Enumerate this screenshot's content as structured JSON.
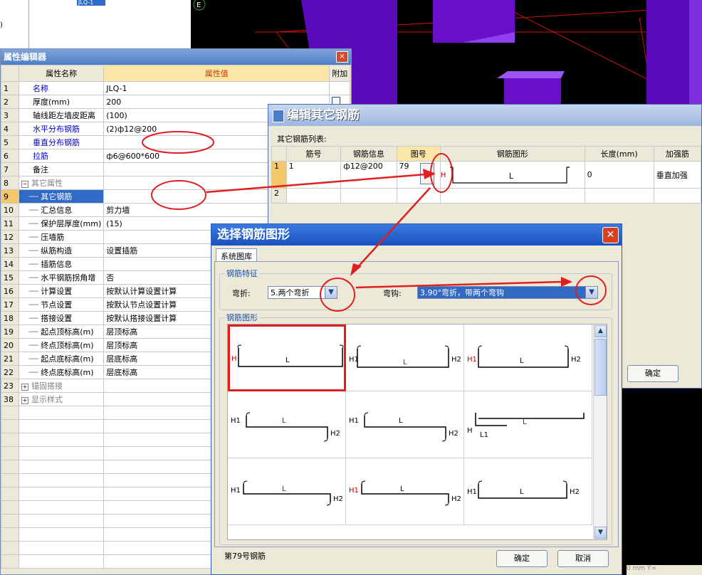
{
  "tree": {
    "selected_node": "JLQ-1",
    "left_fragment": ")"
  },
  "view3d": {
    "axis_label": "E"
  },
  "prop_editor": {
    "title": "属性编辑器",
    "close": "×",
    "headers": {
      "name": "属性名称",
      "value": "属性值",
      "add": "附加"
    },
    "rows": [
      {
        "n": "1",
        "name": "名称",
        "value": "JLQ-1",
        "style": "blue"
      },
      {
        "n": "2",
        "name": "厚度(mm)",
        "value": "200",
        "style": "normal",
        "check": true
      },
      {
        "n": "3",
        "name": "轴线距左墙皮距离",
        "value": "(100)",
        "style": "normal"
      },
      {
        "n": "4",
        "name": "水平分布钢筋",
        "value": "(2)ф12@200",
        "style": "blue"
      },
      {
        "n": "5",
        "name": "垂直分布钢筋",
        "value": "",
        "style": "blue"
      },
      {
        "n": "6",
        "name": "拉筋",
        "value": "ф6@600*600",
        "style": "blue"
      },
      {
        "n": "7",
        "name": "备注",
        "value": "",
        "style": "normal"
      },
      {
        "n": "8",
        "name": "其它属性",
        "value": "",
        "style": "group",
        "toggle": "−"
      },
      {
        "n": "9",
        "name": "其它钢筋",
        "value": "",
        "style": "child-selected"
      },
      {
        "n": "10",
        "name": "汇总信息",
        "value": "剪力墙",
        "style": "child"
      },
      {
        "n": "11",
        "name": "保护层厚度(mm)",
        "value": "(15)",
        "style": "child"
      },
      {
        "n": "12",
        "name": "压墙筋",
        "value": "",
        "style": "child"
      },
      {
        "n": "13",
        "name": "纵筋构造",
        "value": "设置插筋",
        "style": "child"
      },
      {
        "n": "14",
        "name": "插筋信息",
        "value": "",
        "style": "child"
      },
      {
        "n": "15",
        "name": "水平钢筋拐角增",
        "value": "否",
        "style": "child"
      },
      {
        "n": "16",
        "name": "计算设置",
        "value": "按默认计算设置计算",
        "style": "child"
      },
      {
        "n": "17",
        "name": "节点设置",
        "value": "按默认节点设置计算",
        "style": "child"
      },
      {
        "n": "18",
        "name": "搭接设置",
        "value": "按默认搭接设置计算",
        "style": "child"
      },
      {
        "n": "19",
        "name": "起点顶标高(m)",
        "value": "层顶标高",
        "style": "child"
      },
      {
        "n": "20",
        "name": "终点顶标高(m)",
        "value": "层顶标高",
        "style": "child"
      },
      {
        "n": "21",
        "name": "起点底标高(m)",
        "value": "层底标高",
        "style": "child"
      },
      {
        "n": "22",
        "name": "终点底标高(m)",
        "value": "层底标高",
        "style": "child"
      },
      {
        "n": "23",
        "name": "锚固搭接",
        "value": "",
        "style": "group",
        "toggle": "+"
      },
      {
        "n": "38",
        "name": "显示样式",
        "value": "",
        "style": "group",
        "toggle": "+"
      }
    ]
  },
  "edit_dialog": {
    "title": "编辑其它钢筋",
    "list_label": "其它钢筋列表:",
    "headers": [
      "筋号",
      "钢筋信息",
      "图号",
      "钢筋图形",
      "长度(mm)",
      "加强筋"
    ],
    "rows": [
      {
        "n": "1",
        "bar_no": "1",
        "info": "ф12@200",
        "fig_no": "79",
        "dots": "…",
        "shape_h": "H",
        "shape_l": "L",
        "length": "0",
        "extra": "垂直加强"
      },
      {
        "n": "2",
        "bar_no": "",
        "info": "",
        "fig_no": "",
        "dots": "",
        "shape_h": "",
        "shape_l": "",
        "length": "",
        "extra": ""
      }
    ],
    "ok": "确定"
  },
  "choose_dialog": {
    "title": "选择钢筋图形",
    "close": "✕",
    "tab": "系统图库",
    "feature_group": "钢筋特征",
    "bend_label": "弯折:",
    "bend_value": "5.两个弯折",
    "hook_label": "弯钩:",
    "hook_value": "3.90°弯折，带两个弯钩",
    "gallery_group": "钢筋图形",
    "status": "第79号钢筋",
    "ok": "确定",
    "cancel": "取消"
  },
  "coord_bar": "0    mm  Y=",
  "colors": {
    "annotation": "#e02020",
    "column": "#6a0fc9",
    "selection": "#316ac5"
  }
}
